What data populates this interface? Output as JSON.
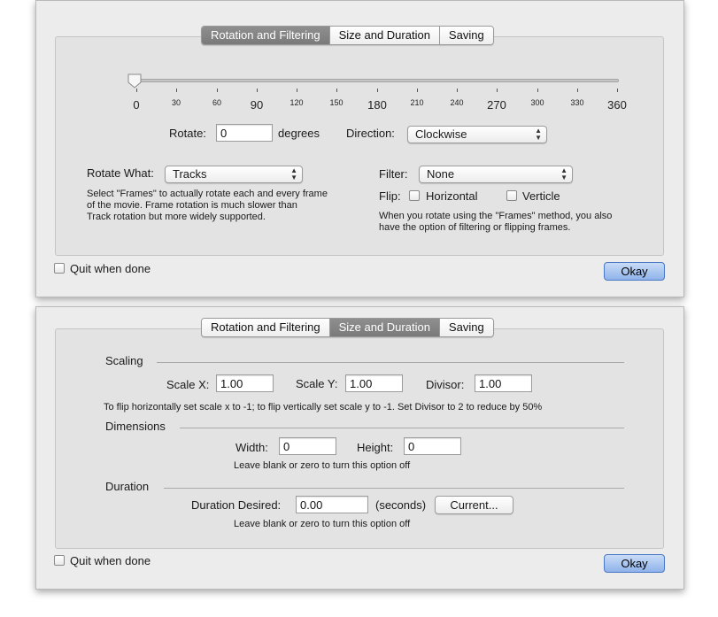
{
  "top_window": {
    "tabs": [
      "Rotation and Filtering",
      "Size and Duration",
      "Saving"
    ],
    "active_tab": "Rotation and Filtering",
    "slider": {
      "value": 0,
      "min": 0,
      "max": 360,
      "ticks": [
        {
          "label": "0",
          "big": true
        },
        {
          "label": "30",
          "big": false
        },
        {
          "label": "60",
          "big": false
        },
        {
          "label": "90",
          "big": true
        },
        {
          "label": "120",
          "big": false
        },
        {
          "label": "150",
          "big": false
        },
        {
          "label": "180",
          "big": true
        },
        {
          "label": "210",
          "big": false
        },
        {
          "label": "240",
          "big": false
        },
        {
          "label": "270",
          "big": true
        },
        {
          "label": "300",
          "big": false
        },
        {
          "label": "330",
          "big": false
        },
        {
          "label": "360",
          "big": true
        }
      ]
    },
    "rotate_label": "Rotate:",
    "rotate_value": "0",
    "degrees_label": "degrees",
    "direction_label": "Direction:",
    "direction_value": "Clockwise",
    "rotate_what_label": "Rotate What:",
    "rotate_what_value": "Tracks",
    "rotate_what_help_1": "Select \"Frames\" to actually rotate each and every frame",
    "rotate_what_help_2": "of the movie.  Frame rotation is much slower than",
    "rotate_what_help_3": "Track rotation but more widely supported.",
    "filter_label": "Filter:",
    "filter_value": "None",
    "flip_label": "Flip:",
    "horizontal_label": "Horizontal",
    "horizontal_checked": false,
    "verticle_label": "Verticle",
    "verticle_checked": false,
    "filter_help_1": "When you rotate using the \"Frames\" method, you also",
    "filter_help_2": "have the option of filtering or flipping frames.",
    "quit_label": "Quit when done",
    "quit_checked": false,
    "okay_label": "Okay"
  },
  "bottom_window": {
    "tabs": [
      "Rotation and Filtering",
      "Size and Duration",
      "Saving"
    ],
    "active_tab": "Size and Duration",
    "scaling_heading": "Scaling",
    "scale_x_label": "Scale X:",
    "scale_x_value": "1.00",
    "scale_y_label": "Scale Y:",
    "scale_y_value": "1.00",
    "divisor_label": "Divisor:",
    "divisor_value": "1.00",
    "scaling_help": "To flip horizontally set scale x to -1; to flip vertically set scale y to -1. Set Divisor to 2 to reduce by 50%",
    "dimensions_heading": "Dimensions",
    "width_label": "Width:",
    "width_value": "0",
    "height_label": "Height:",
    "height_value": "0",
    "dimensions_help": "Leave blank or zero to turn this option off",
    "duration_heading": "Duration",
    "duration_desired_label": "Duration Desired:",
    "duration_desired_value": "0.00",
    "seconds_label": "(seconds)",
    "current_button": "Current...",
    "duration_help": "Leave blank or zero to turn this option off",
    "quit_label": "Quit when done",
    "quit_checked": false,
    "okay_label": "Okay"
  }
}
